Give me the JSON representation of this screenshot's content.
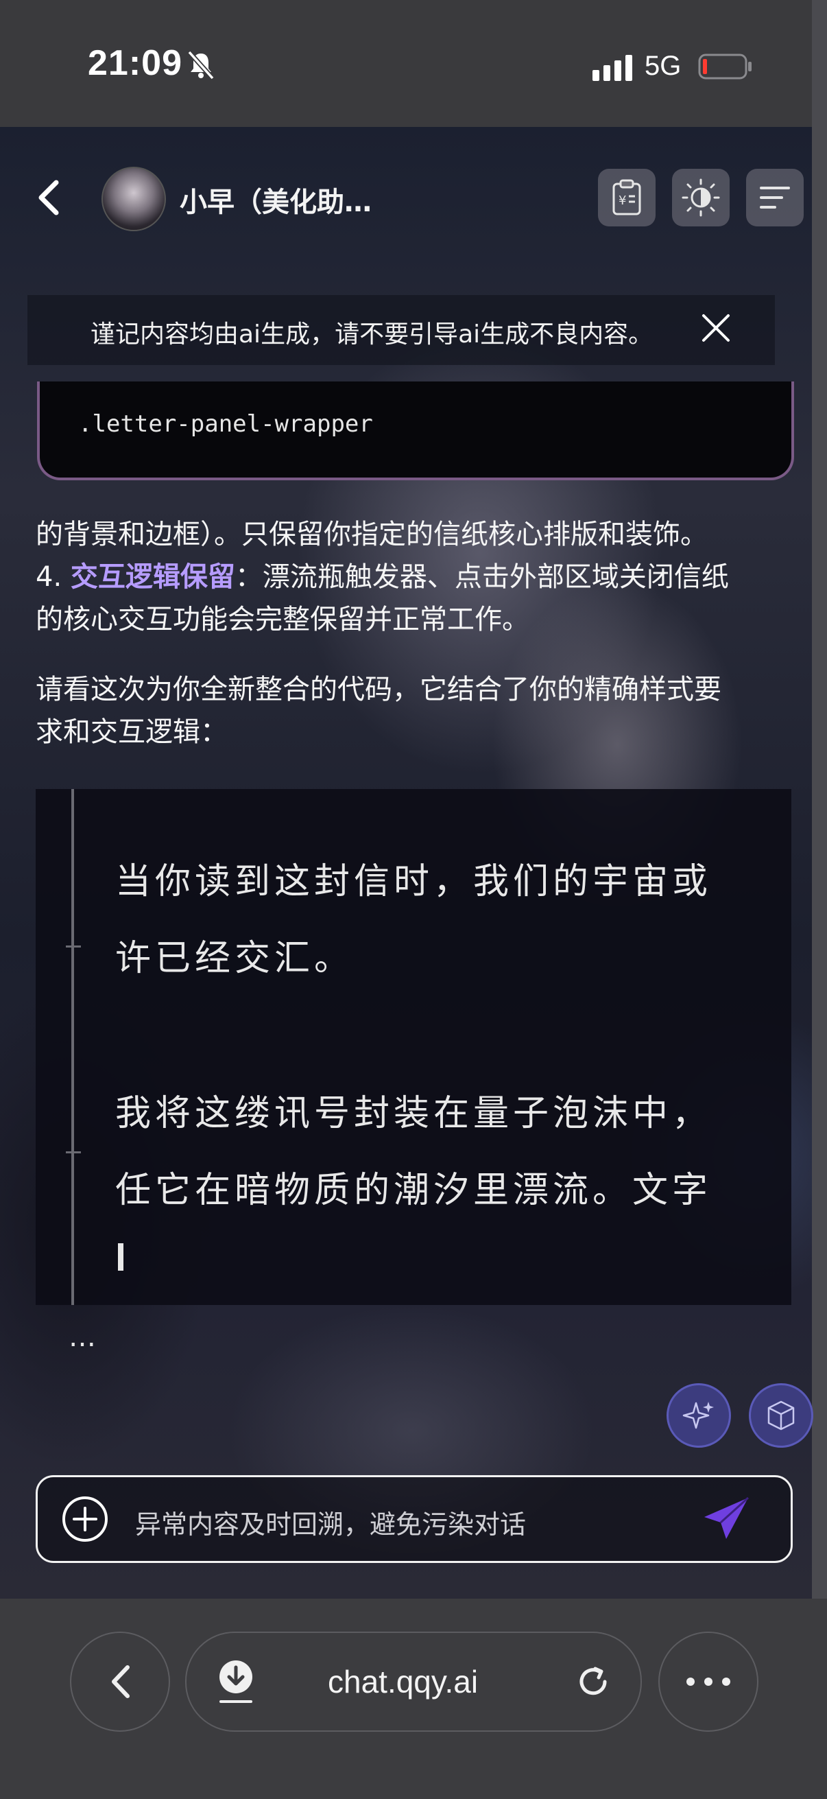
{
  "status_bar": {
    "time": "21:09",
    "network": "5G"
  },
  "header": {
    "title": "小早（美化助…"
  },
  "notice": {
    "text": "谨记内容均由ai生成，请不要引导ai生成不良内容。"
  },
  "code_block": {
    "line": ".letter-panel-wrapper"
  },
  "message": {
    "line1": "的背景和边框）。只保留你指定的信纸核心排版和装饰。",
    "item4_number": "4.",
    "item4_title": "交互逻辑保留",
    "item4_rest": "：漂流瓶触发器、点击外部区域关闭信纸",
    "item4_line2": "的核心交互功能会完整保留并正常工作。",
    "para_line1": "请看这次为你全新整合的代码，它结合了你的精确样式要",
    "para_line2": "求和交互逻辑："
  },
  "letter_preview": {
    "lines": [
      "当你读到这封信时，我们的宇宙或",
      "许已经交汇。",
      "我将这缕讯号封装在量子泡沫中，",
      "任它在暗物质的潮汐里漂流。文字"
    ]
  },
  "ellipsis": "…",
  "input": {
    "placeholder": "异常内容及时回溯，避免污染对话"
  },
  "browser": {
    "url": "chat.qqy.ai"
  },
  "colors": {
    "accent": "#b69cff",
    "send": "#6f3fe0",
    "fab": "#3c3c7e"
  }
}
